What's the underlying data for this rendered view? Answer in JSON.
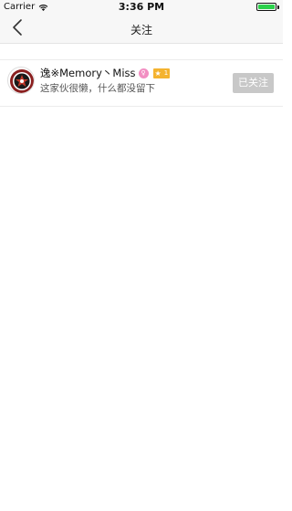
{
  "status_bar": {
    "carrier": "Carrier",
    "time": "3:36 PM",
    "battery_color": "#2bd14b"
  },
  "nav": {
    "title": "关注",
    "back_icon": "chevron-left-icon"
  },
  "following": [
    {
      "name": "逸※Memory丶Miss",
      "gender_badge": "♀",
      "level_star": "★",
      "level": "1",
      "signature": "这家伙很懒，什么都没留下",
      "button_label": "已关注"
    }
  ],
  "colors": {
    "gender_badge": "#f28ec2",
    "level_badge": "#f4b32f",
    "followed_button": "#c8c8c8"
  }
}
